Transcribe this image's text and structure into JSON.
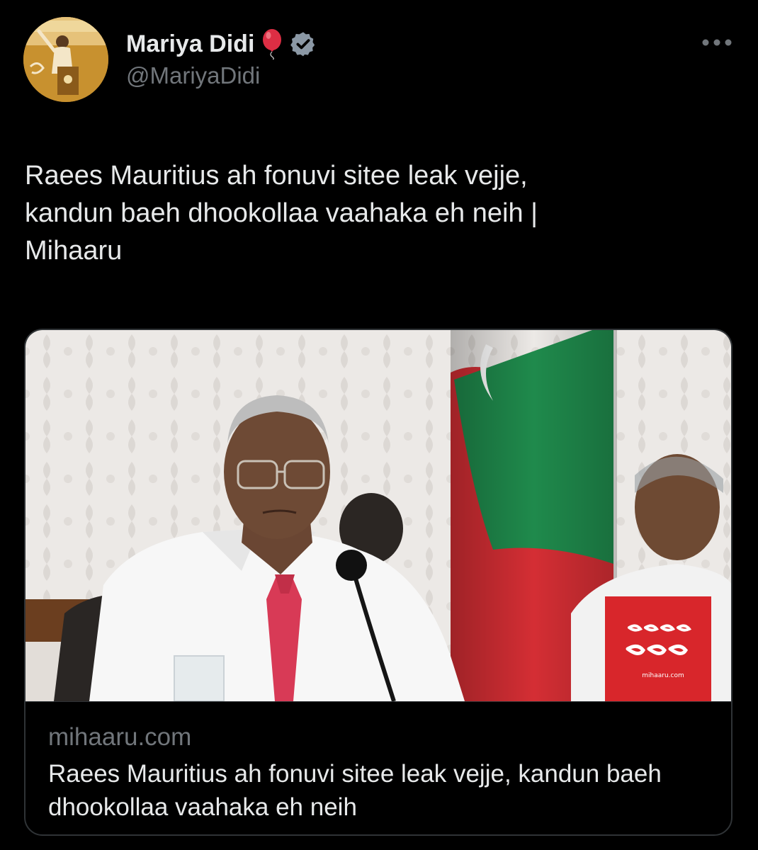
{
  "user": {
    "display_name": "Mariya Didi",
    "handle": "@MariyaDidi",
    "name_emoji": "balloon-icon",
    "verified": true
  },
  "tweet": {
    "text": "Raees Mauritius ah fonuvi sitee leak vejje,\nkandun baeh dhookollaa vaahaka eh neih |\nMihaaru"
  },
  "card": {
    "domain": "mihaaru.com",
    "title": "Raees Mauritius ah fonuvi sitee leak vejje, kandun baeh dhookollaa vaahaka eh neih",
    "image_logo_caption": "mihaaru.com"
  },
  "colors": {
    "background": "#000000",
    "text": "#e7e9ea",
    "secondary_text": "#71767b",
    "border": "#2f3336",
    "verified_badge": "#8b98a5",
    "logo_red": "#d8262b"
  }
}
